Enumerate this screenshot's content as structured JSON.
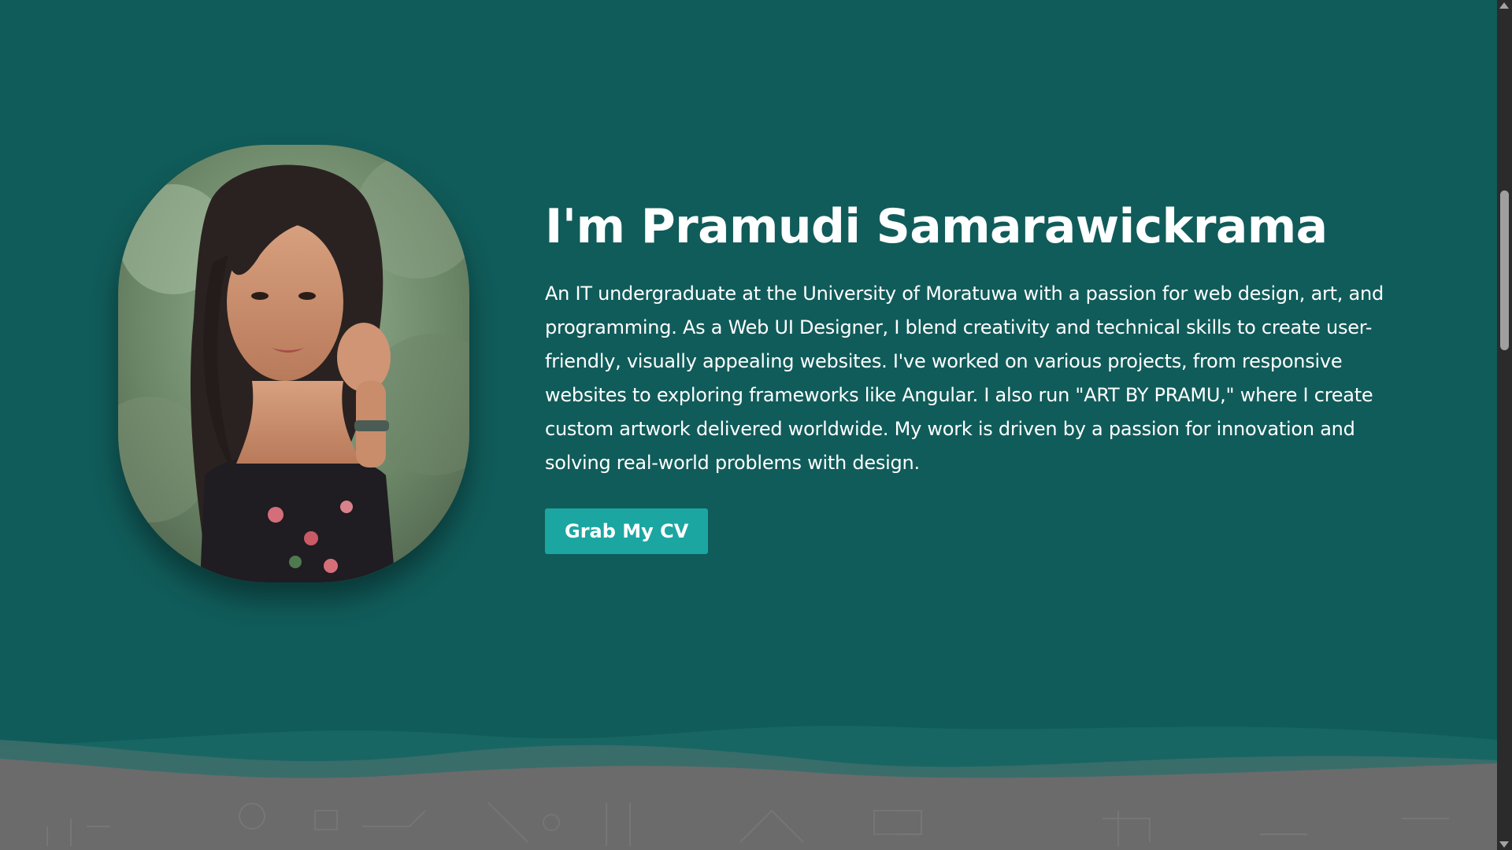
{
  "hero": {
    "title": "I'm Pramudi Samarawickrama",
    "bio": "An IT undergraduate at the University of Moratuwa with a passion for web design, art, and programming. As a Web UI Designer, I blend creativity and technical skills to create user-friendly, visually appealing websites. I've worked on various projects, from responsive websites to exploring frameworks like Angular. I also run \"ART BY PRAMU,\" where I create custom artwork delivered worldwide. My work is driven by a passion for innovation and solving real-world problems with design.",
    "cv_button_label": "Grab My CV"
  },
  "colors": {
    "background": "#105c5a",
    "button": "#1ba6a2",
    "footer": "#6b6b6b",
    "scrollbar": "#2b2b2b"
  }
}
